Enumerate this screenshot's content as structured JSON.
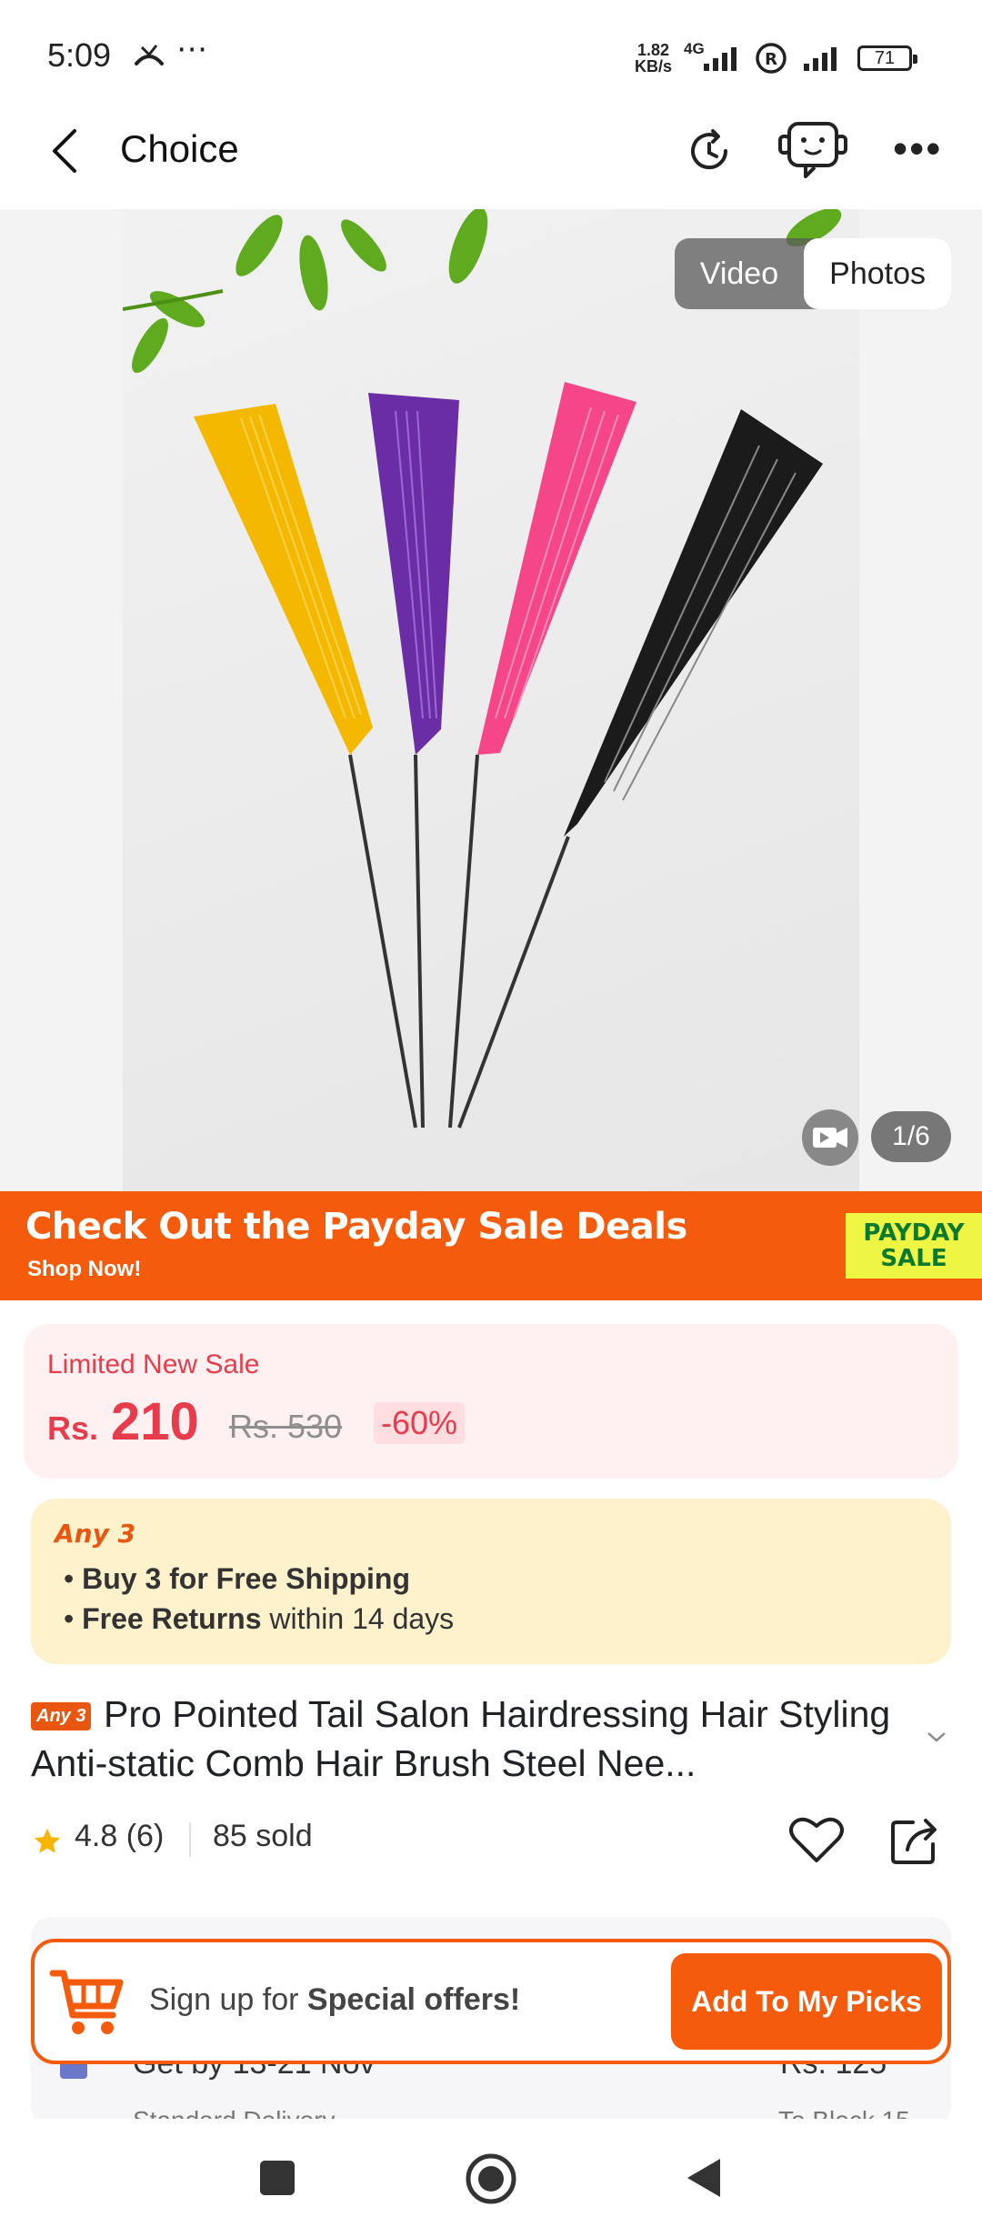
{
  "status_bar": {
    "time": "5:09",
    "net_speed_value": "1.82",
    "net_speed_unit": "KB/s",
    "network": "4G",
    "battery": "71"
  },
  "header": {
    "title": "Choice"
  },
  "gallery": {
    "toggle_video": "Video",
    "toggle_photos": "Photos",
    "counter": "1/6"
  },
  "promo_banner": {
    "title": "Check Out the Payday Sale Deals",
    "subtitle": "Shop Now!",
    "badge_line1": "PAYDAY",
    "badge_line2": "SALE"
  },
  "price": {
    "label": "Limited New Sale",
    "currency": "Rs.",
    "amount": "210",
    "original": "Rs. 530",
    "discount": "-60%"
  },
  "offers": {
    "tag": "Any 3",
    "line1_bold": "Buy 3 for  Free Shipping",
    "line2_bold": "Free Returns",
    "line2_rest": " within 14 days"
  },
  "product": {
    "tag": "Any 3",
    "title": "Pro Pointed Tail Salon Hairdressing Hair Styling Anti-static Comb Hair Brush Steel Nee...",
    "rating": "4.8",
    "reviews": "(6)",
    "sold": "85 sold"
  },
  "delivery": {
    "date": "Get by 13-21 Nov",
    "price": "Rs. 125",
    "type": "Standard Delivery",
    "block": "To Block 15"
  },
  "signup": {
    "text_prefix": "Sign up for ",
    "text_bold": "Special offers!",
    "button": "Add To My Picks"
  },
  "colors": {
    "accent": "#f45b0c",
    "price_red": "#e73c4c",
    "offer_bg": "#fdf2cc",
    "price_bg": "#fff0f1"
  }
}
